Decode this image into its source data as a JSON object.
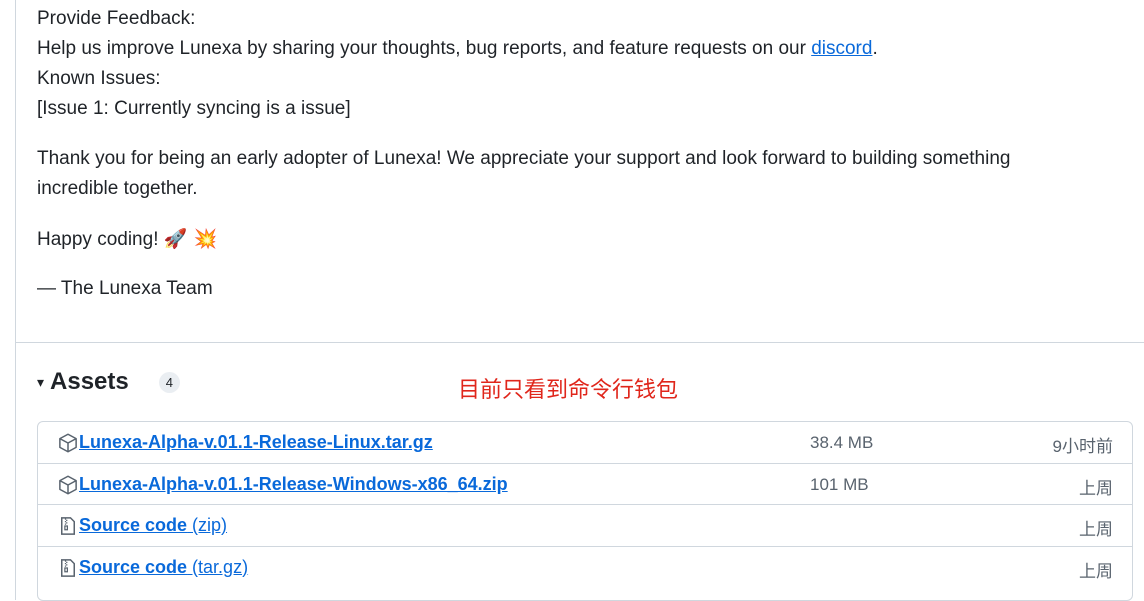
{
  "release_notes": {
    "feedback_heading": "Provide Feedback:",
    "feedback_text": "Help us improve Lunexa by sharing your thoughts, bug reports, and feature requests on our ",
    "feedback_link": "discord",
    "feedback_end": ".",
    "known_issues_heading": "Known Issues:",
    "issue_1": "[Issue 1: Currently syncing is a issue]",
    "thanks_line1": "Thank you for being an early adopter of Lunexa! We appreciate your support and look forward to building something",
    "thanks_line2": "incredible together.",
    "happy_coding": "Happy coding!",
    "emojis": "🚀 💥",
    "signature": "— The Lunexa Team"
  },
  "assets": {
    "caret": "▾",
    "title": "Assets",
    "count": "4",
    "annotation": "目前只看到命令行钱包",
    "items": [
      {
        "icon": "package-icon",
        "name": "Lunexa-Alpha-v.01.1-Release-Linux.tar.gz",
        "sub": "",
        "size": "38.4 MB",
        "date": "9小时前"
      },
      {
        "icon": "package-icon",
        "name": "Lunexa-Alpha-v.01.1-Release-Windows-x86_64.zip",
        "sub": "",
        "size": "101 MB",
        "date": "上周"
      },
      {
        "icon": "file-zip-icon",
        "name": "Source code",
        "sub": " (zip)",
        "size": "",
        "date": "上周"
      },
      {
        "icon": "file-zip-icon",
        "name": "Source code",
        "sub": " (tar.gz)",
        "size": "",
        "date": "上周"
      }
    ]
  }
}
